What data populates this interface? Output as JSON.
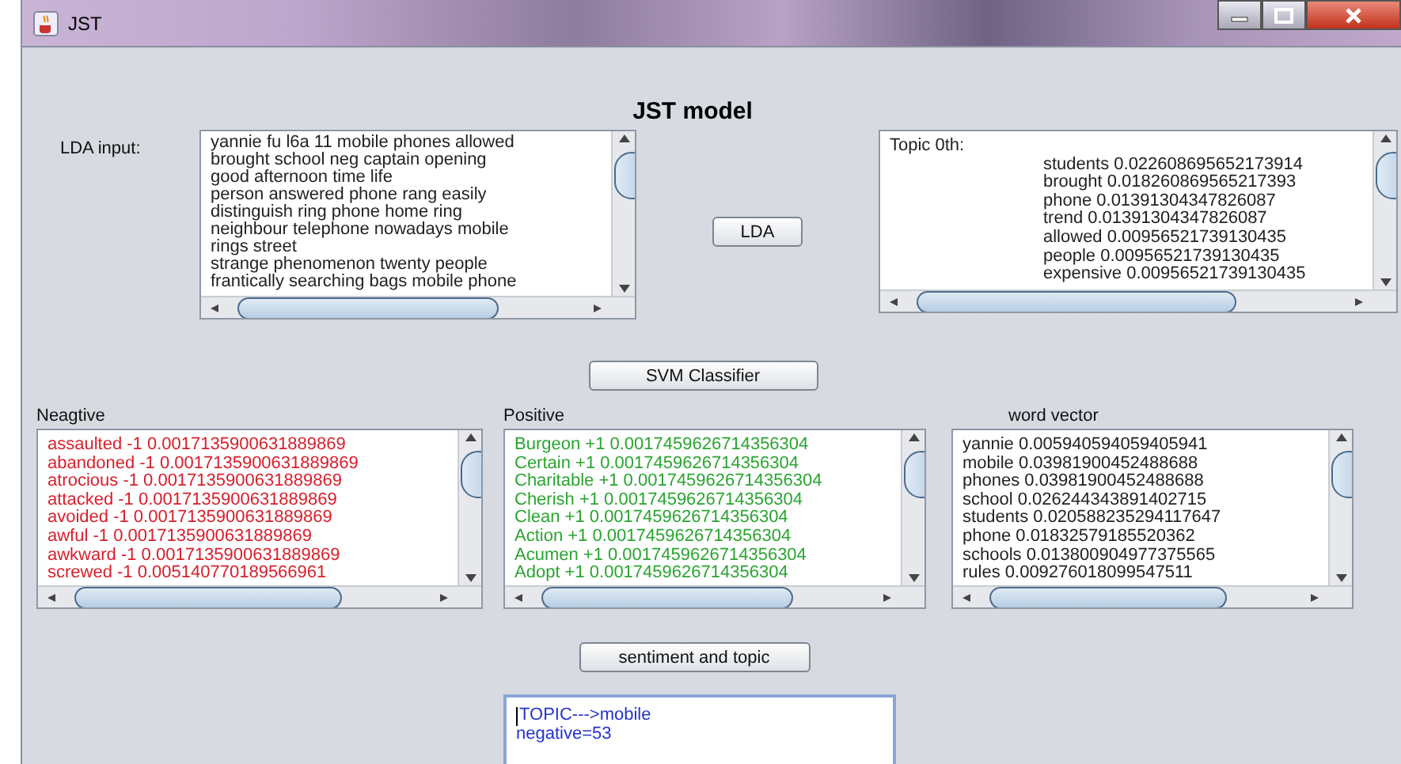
{
  "window": {
    "title": "JST"
  },
  "heading": "JST model",
  "lda_input": {
    "label": "LDA input:",
    "lines": [
      "yannie fu l6a 11 mobile phones allowed",
      "brought school neg captain opening",
      "good afternoon time life",
      "person answered phone rang easily",
      "distinguish ring phone home ring",
      "neighbour telephone nowadays mobile",
      "rings street",
      "strange phenomenon twenty people",
      "frantically searching bags mobile phone"
    ]
  },
  "lda_button": "LDA",
  "topic": {
    "heading": "Topic 0th:",
    "lines": [
      "students 0.022608695652173914",
      "brought 0.018260869565217393",
      "phone 0.01391304347826087",
      "trend 0.01391304347826087",
      "allowed 0.00956521739130435",
      "people 0.00956521739130435",
      "expensive 0.00956521739130435"
    ]
  },
  "svm_button": "SVM Classifier",
  "panels": [
    {
      "label": "Neagtive",
      "kind": "negative",
      "lines": [
        "assaulted -1 0.0017135900631889869",
        "abandoned -1 0.0017135900631889869",
        "atrocious -1 0.0017135900631889869",
        "attacked -1 0.0017135900631889869",
        "avoided -1 0.0017135900631889869",
        "awful -1 0.0017135900631889869",
        "awkward -1 0.0017135900631889869",
        "screwed -1 0.005140770189566961"
      ]
    },
    {
      "label": "Positive",
      "kind": "positive",
      "lines": [
        "Burgeon +1 0.0017459626714356304",
        "Certain +1 0.0017459626714356304",
        "Charitable +1 0.0017459626714356304",
        "Cherish +1 0.0017459626714356304",
        "Clean +1 0.0017459626714356304",
        "Action +1 0.0017459626714356304",
        "Acumen +1 0.0017459626714356304",
        "Adopt +1 0.0017459626714356304"
      ]
    },
    {
      "label": "word vector",
      "kind": "plain",
      "lines": [
        "yannie 0.005940594059405941",
        "mobile 0.03981900452488688",
        "phones 0.03981900452488688",
        "school 0.026244343891402715",
        "students 0.020588235294117647",
        "phone 0.01832579185520362",
        "schools 0.013800904977375565",
        "rules 0.009276018099547511"
      ]
    }
  ],
  "sentiment_button": "sentiment and topic",
  "output": {
    "lines": [
      "TOPIC--->mobile",
      "negative=53"
    ]
  }
}
